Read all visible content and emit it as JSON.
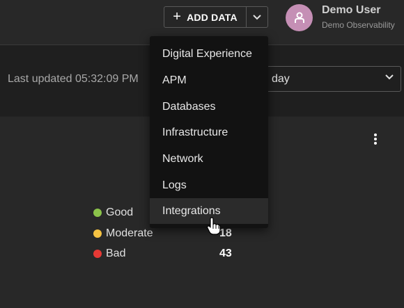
{
  "header": {
    "add_data_label": "ADD DATA",
    "user": {
      "name": "Demo User",
      "org": "Demo Observability"
    }
  },
  "toolbar": {
    "last_updated": "Last updated 05:32:09 PM",
    "time_range_value": "day"
  },
  "add_data_menu": {
    "items": [
      "Digital Experience",
      "APM",
      "Databases",
      "Infrastructure",
      "Network",
      "Logs",
      "Integrations"
    ],
    "hovered": "Integrations"
  },
  "legend": [
    {
      "label": "Good",
      "value": "",
      "color": "#8bc34a"
    },
    {
      "label": "Moderate",
      "value": "18",
      "color": "#f5c242"
    },
    {
      "label": "Bad",
      "value": "43",
      "color": "#e53935"
    }
  ],
  "colors": {
    "background": "#232323",
    "menu": "#121212",
    "avatar": "#c58fb5"
  }
}
